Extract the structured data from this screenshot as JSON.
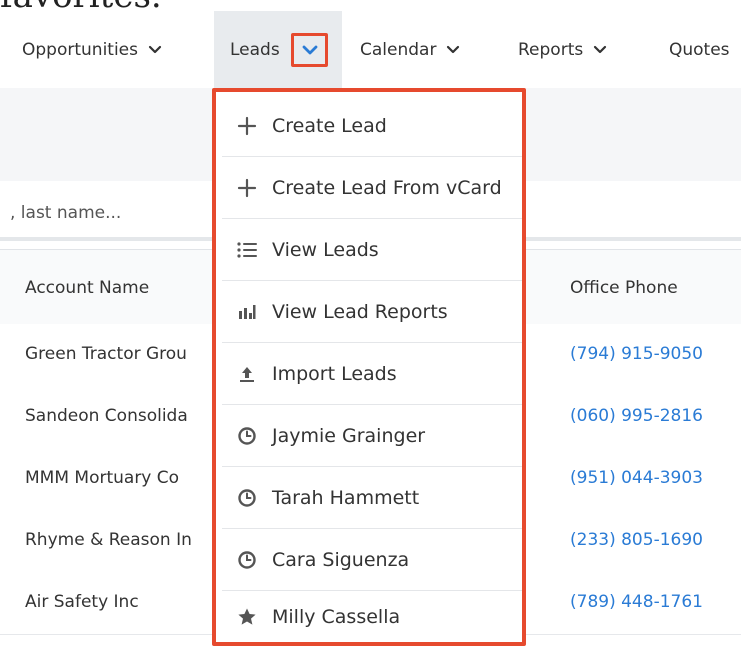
{
  "page": {
    "clipped_heading": "favorites."
  },
  "nav": {
    "items": [
      {
        "label": "Opportunities"
      },
      {
        "label": "Leads"
      },
      {
        "label": "Calendar"
      },
      {
        "label": "Reports"
      },
      {
        "label": "Quotes"
      }
    ],
    "active": "Leads",
    "accent_color": "#e64a2e",
    "chevron_color": "#2a7bd5"
  },
  "search": {
    "placeholder": ", last name..."
  },
  "table": {
    "headers": [
      "Account Name",
      "Office Phone"
    ],
    "rows": [
      {
        "account": "Green Tractor Grou",
        "phone": "(794) 915-9050"
      },
      {
        "account": "Sandeon Consolida",
        "phone": "(060) 995-2816"
      },
      {
        "account": "MMM Mortuary Co",
        "phone": "(951) 044-3903"
      },
      {
        "account": "Rhyme & Reason In",
        "phone": "(233) 805-1690"
      },
      {
        "account": "Air Safety Inc",
        "phone": "(789) 448-1761"
      }
    ],
    "link_color": "#2a7bd5"
  },
  "dropdown": {
    "items": [
      {
        "label": "Create Lead",
        "icon": "plus-icon"
      },
      {
        "label": "Create Lead From vCard",
        "icon": "plus-icon"
      },
      {
        "label": "View Leads",
        "icon": "list-icon"
      },
      {
        "label": "View Lead Reports",
        "icon": "bar-chart-icon"
      },
      {
        "label": "Import Leads",
        "icon": "upload-icon"
      },
      {
        "label": "Jaymie Grainger",
        "icon": "clock-icon"
      },
      {
        "label": "Tarah Hammett",
        "icon": "clock-icon"
      },
      {
        "label": "Cara Siguenza",
        "icon": "clock-icon"
      },
      {
        "label": "Milly Cassella",
        "icon": "star-icon"
      }
    ]
  }
}
